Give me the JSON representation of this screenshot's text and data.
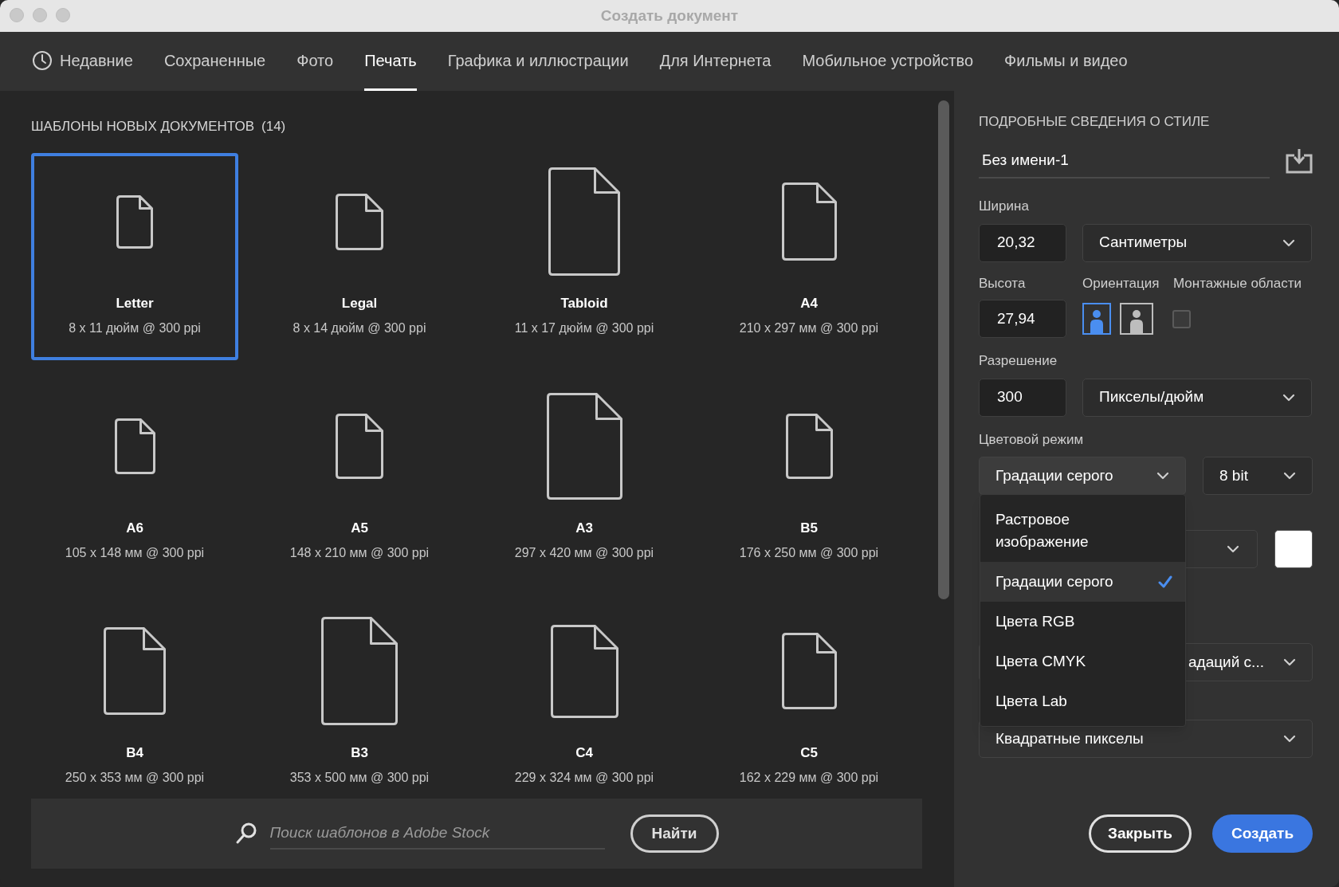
{
  "window": {
    "title": "Создать документ"
  },
  "tabs": [
    {
      "label": "Недавние",
      "kind": "history",
      "selected": false
    },
    {
      "label": "Сохраненные",
      "kind": "plain",
      "selected": false
    },
    {
      "label": "Фото",
      "kind": "plain",
      "selected": false
    },
    {
      "label": "Печать",
      "kind": "plain",
      "selected": true
    },
    {
      "label": "Графика и иллюстрации",
      "kind": "plain",
      "selected": false
    },
    {
      "label": "Для Интернета",
      "kind": "plain",
      "selected": false
    },
    {
      "label": "Мобильное устройство",
      "kind": "plain",
      "selected": false
    },
    {
      "label": "Фильмы и видео",
      "kind": "plain",
      "selected": false
    }
  ],
  "templates": {
    "heading": "ШАБЛОНЫ НОВЫХ ДОКУМЕНТОВ",
    "count": "(14)",
    "items": [
      {
        "name": "Letter",
        "size": "8 x 11 дюйм @ 300 ppi",
        "selected": true
      },
      {
        "name": "Legal",
        "size": "8 x 14 дюйм @ 300 ppi",
        "selected": false
      },
      {
        "name": "Tabloid",
        "size": "11 x 17 дюйм @ 300 ppi",
        "selected": false
      },
      {
        "name": "A4",
        "size": "210 x 297 мм @ 300 ppi",
        "selected": false
      },
      {
        "name": "A6",
        "size": "105 x 148 мм @ 300 ppi",
        "selected": false
      },
      {
        "name": "A5",
        "size": "148 x 210 мм @ 300 ppi",
        "selected": false
      },
      {
        "name": "A3",
        "size": "297 x 420 мм @ 300 ppi",
        "selected": false
      },
      {
        "name": "B5",
        "size": "176 x 250 мм @ 300 ppi",
        "selected": false
      },
      {
        "name": "B4",
        "size": "250 x 353 мм @ 300 ppi",
        "selected": false
      },
      {
        "name": "B3",
        "size": "353 x 500 мм @ 300 ppi",
        "selected": false
      },
      {
        "name": "C4",
        "size": "229 x 324 мм @ 300 ppi",
        "selected": false
      },
      {
        "name": "C5",
        "size": "162 x 229 мм @ 300 ppi",
        "selected": false
      }
    ]
  },
  "search": {
    "placeholder": "Поиск шаблонов в Adobe Stock",
    "button": "Найти"
  },
  "details": {
    "heading": "ПОДРОБНЫЕ СВЕДЕНИЯ О СТИЛЕ",
    "name": "Без имени-1",
    "width": {
      "label": "Ширина",
      "value": "20,32",
      "unit": "Сантиметры"
    },
    "height": {
      "label": "Высота",
      "value": "27,94"
    },
    "orientation": {
      "label": "Ориентация",
      "options": [
        {
          "kind": "portrait",
          "selected": true
        },
        {
          "kind": "landscape",
          "selected": false
        }
      ]
    },
    "artboards": {
      "label": "Монтажные области",
      "checked": false
    },
    "resolution": {
      "label": "Разрешение",
      "value": "300",
      "unit": "Пикселы/дюйм"
    },
    "color_mode": {
      "label": "Цветовой режим",
      "value": "Градации серого",
      "depth": "8 bit",
      "menu": [
        {
          "label": "Растровое изображение",
          "selected": false
        },
        {
          "label": "Градации серого",
          "selected": true
        },
        {
          "label": "Цвета RGB",
          "selected": false
        },
        {
          "label": "Цвета CMYK",
          "selected": false
        },
        {
          "label": "Цвета Lab",
          "selected": false
        }
      ]
    },
    "background_color": {
      "color": "#ffffff"
    },
    "color_profile": {
      "value": "адаций с..."
    },
    "pixel_aspect": {
      "value": "Квадратные пикселы"
    }
  },
  "buttons": {
    "close": "Закрыть",
    "create": "Создать"
  }
}
